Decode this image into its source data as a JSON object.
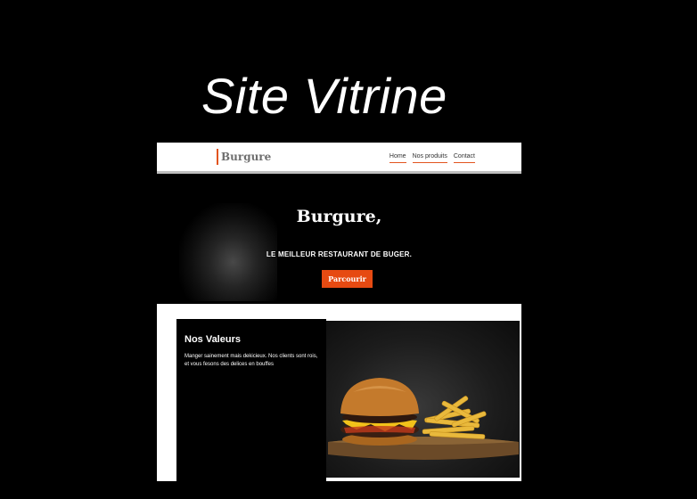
{
  "page": {
    "heading": "Site Vitrine"
  },
  "site": {
    "nav": {
      "logo": "Burgure",
      "links": [
        "Home",
        "Nos produits",
        "Contact"
      ]
    },
    "hero": {
      "title": "Burgure,",
      "subtitle": "LE MEILLEUR RESTAURANT DE BUGER.",
      "button_label": "Parcourir"
    },
    "values": {
      "title": "Nos Valeurs",
      "text": "Manger sainement mais dekicieux. Nos clients sont rois, et vous fesons des delices en bouffes"
    }
  },
  "colors": {
    "accent": "#e64a12",
    "background": "#000000",
    "navbar": "#ffffff"
  }
}
